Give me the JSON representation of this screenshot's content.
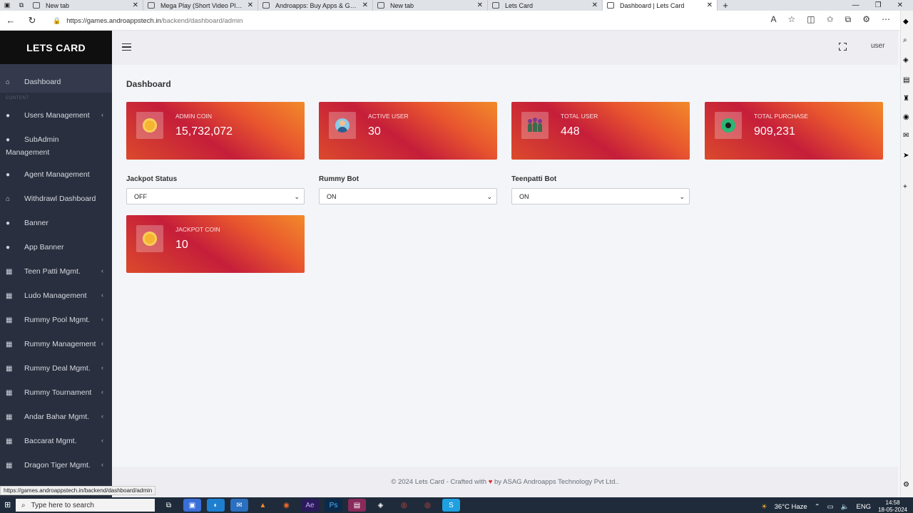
{
  "browser": {
    "tabs": [
      {
        "title": "New tab",
        "active": false
      },
      {
        "title": "Mega Play (Short Video Platform",
        "active": false
      },
      {
        "title": "Androapps: Buy Apps & Games",
        "active": false
      },
      {
        "title": "New tab",
        "active": false
      },
      {
        "title": "Lets Card",
        "active": false
      },
      {
        "title": "Dashboard | Lets Card",
        "active": true
      }
    ],
    "url_host": "https://games.androappstech.in",
    "url_path": "/backend/dashboard/admin",
    "status_url": "https://games.androappstech.in/backend/dashboard/admin"
  },
  "sidebar": {
    "brand": "LETS CARD",
    "section_label": "CONTENT",
    "items": [
      {
        "label": "Dashboard",
        "icon": "home-icon",
        "chevron": false
      },
      {
        "label": "Users Management",
        "icon": "user-icon",
        "chevron": true
      },
      {
        "label": "SubAdmin",
        "label2": "Management",
        "icon": "user-icon",
        "chevron": false
      },
      {
        "label": "Agent Management",
        "icon": "user-icon",
        "chevron": false
      },
      {
        "label": "Withdrawl Dashboard",
        "icon": "home-icon",
        "chevron": false
      },
      {
        "label": "Banner",
        "icon": "user-icon",
        "chevron": false
      },
      {
        "label": "App Banner",
        "icon": "user-icon",
        "chevron": false
      },
      {
        "label": "Teen Patti Mgmt.",
        "icon": "grid-icon",
        "chevron": true
      },
      {
        "label": "Ludo Management",
        "icon": "grid-icon",
        "chevron": true
      },
      {
        "label": "Rummy Pool Mgmt.",
        "icon": "grid-icon",
        "chevron": true
      },
      {
        "label": "Rummy Management",
        "icon": "grid-icon",
        "chevron": true
      },
      {
        "label": "Rummy Deal Mgmt.",
        "icon": "grid-icon",
        "chevron": true
      },
      {
        "label": "Rummy Tournament",
        "icon": "grid-icon",
        "chevron": true
      },
      {
        "label": "Andar Bahar Mgmt.",
        "icon": "grid-icon",
        "chevron": true
      },
      {
        "label": "Baccarat Mgmt.",
        "icon": "grid-icon",
        "chevron": true
      },
      {
        "label": "Dragon Tiger Mgmt.",
        "icon": "grid-icon",
        "chevron": true
      }
    ]
  },
  "topbar": {
    "user_label": "user"
  },
  "page": {
    "title": "Dashboard"
  },
  "stats": [
    {
      "label": "ADMIN COIN",
      "value": "15,732,072",
      "icon": "coin-icon"
    },
    {
      "label": "ACTIVE USER",
      "value": "30",
      "icon": "active-user-icon"
    },
    {
      "label": "TOTAL USER",
      "value": "448",
      "icon": "users-group-icon"
    },
    {
      "label": "TOTAL PURCHASE",
      "value": "909,231",
      "icon": "purchase-icon"
    }
  ],
  "settings": {
    "jackpot_status": {
      "label": "Jackpot Status",
      "value": "OFF"
    },
    "rummy_bot": {
      "label": "Rummy Bot",
      "value": "ON"
    },
    "teenpatti_bot": {
      "label": "Teenpatti Bot",
      "value": "ON"
    }
  },
  "jackpot": {
    "label": "JACKPOT COIN",
    "value": "10",
    "icon": "coin-icon"
  },
  "footer": {
    "prefix": "© 2024 Lets Card - Crafted with",
    "suffix": "by ASAG Androapps Technology Pvt Ltd.."
  },
  "taskbar": {
    "search_placeholder": "Type here to search",
    "weather": "36°C  Haze",
    "lang": "ENG",
    "time": "14:58",
    "date": "18-05-2024"
  },
  "colors": {
    "card_gradient_start": "#f28a2a",
    "card_gradient_mid": "#c51e3a",
    "sidebar_bg": "#2a2f3f",
    "brand_bg": "#0f0f0f"
  }
}
